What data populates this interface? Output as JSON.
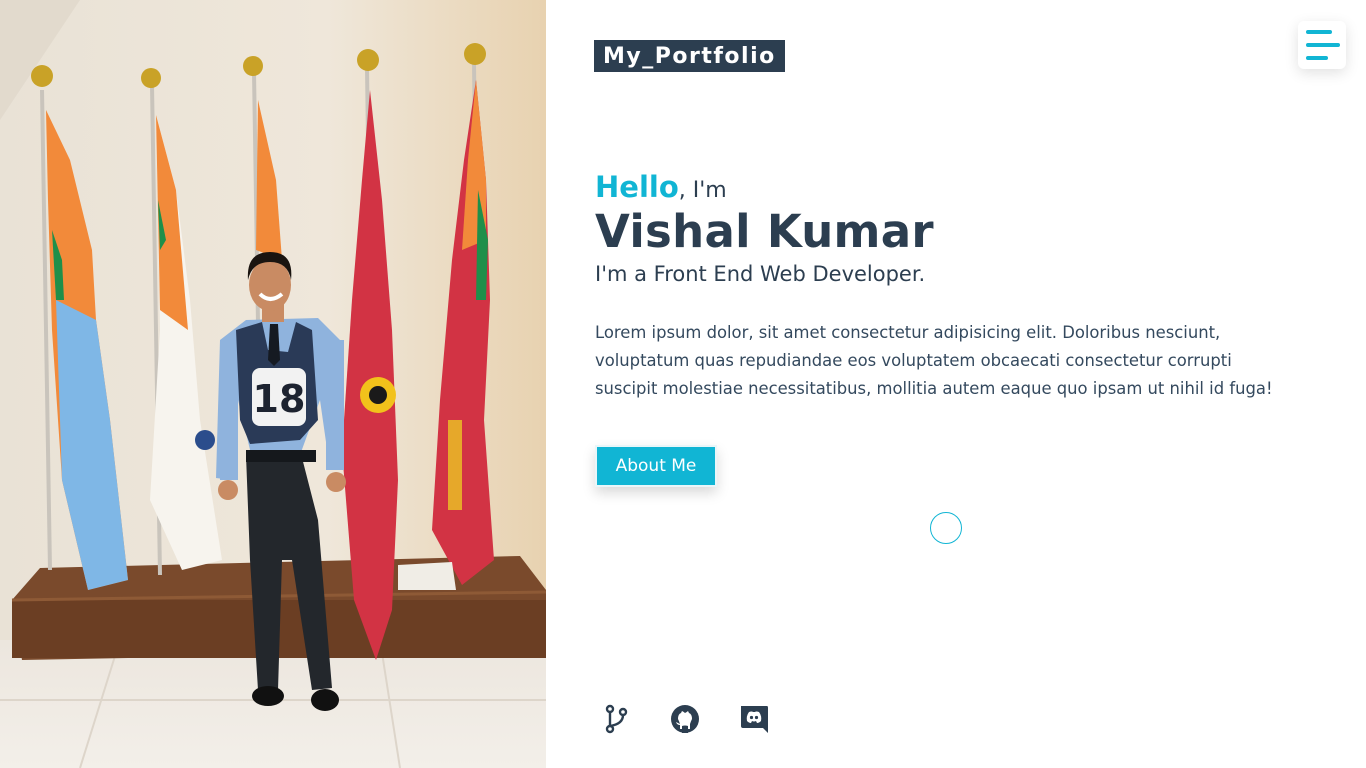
{
  "header": {
    "logo": "My_Portfolio",
    "menu_icon": "hamburger-menu-icon"
  },
  "hero": {
    "hello": "Hello",
    "greeting_rest": ", I'm",
    "name": "Vishal Kumar",
    "role": "I'm a Front End Web Developer.",
    "description": "Lorem ipsum dolor, sit amet consectetur adipisicing elit. Doloribus nesciunt, voluptatum quas repudiandae eos voluptatem obcaecati consectetur corrupti suscipit molestiae necessitatibus, mollitia autem eaque quo ipsam ut nihil id fuga!",
    "button_label": "About Me"
  },
  "photo": {
    "bib_number": "18"
  },
  "socials": [
    {
      "icon": "git-branch-icon"
    },
    {
      "icon": "github-icon"
    },
    {
      "icon": "discord-icon"
    }
  ],
  "colors": {
    "accent": "#11b5d4",
    "dark": "#2c3e50",
    "text": "#34495e",
    "background": "#ffffff"
  }
}
